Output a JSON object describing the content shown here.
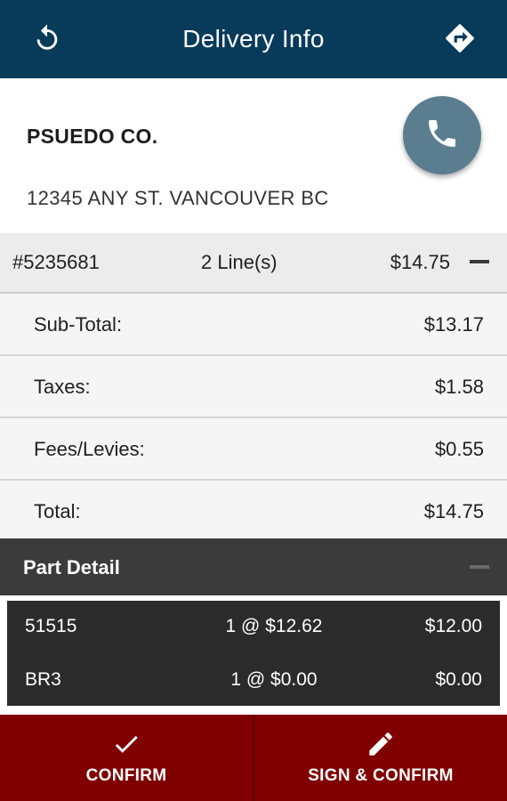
{
  "appbar": {
    "title": "Delivery Info",
    "left_icon": "refresh-icon",
    "right_icon": "directions-icon"
  },
  "customer": {
    "name": "PSUEDO CO.",
    "address": "12345 ANY ST. VANCOUVER BC",
    "call_icon": "phone-icon"
  },
  "order": {
    "number": "#5235681",
    "lines": "2 Line(s)",
    "amount": "$14.75"
  },
  "summary": [
    {
      "label": "Sub-Total:",
      "value": "$13.17"
    },
    {
      "label": "Taxes:",
      "value": "$1.58"
    },
    {
      "label": "Fees/Levies:",
      "value": "$0.55"
    },
    {
      "label": "Total:",
      "value": "$14.75"
    }
  ],
  "part_detail": {
    "label": "Part Detail",
    "rows": [
      {
        "part": "51515",
        "qty_price": "1 @ $12.62",
        "total": "$12.00"
      },
      {
        "part": "BR3",
        "qty_price": "1 @ $0.00",
        "total": "$0.00"
      }
    ]
  },
  "actions": {
    "confirm_label": "CONFIRM",
    "confirm_icon": "check-icon",
    "sign_confirm_label": "SIGN & CONFIRM",
    "sign_confirm_icon": "pencil-icon"
  },
  "colors": {
    "appbar": "#083a5a",
    "call_button": "#5a7d90",
    "part_header": "#3b3b3b",
    "parts_bg": "#2b2b2b",
    "bottom_bar": "#800000"
  }
}
